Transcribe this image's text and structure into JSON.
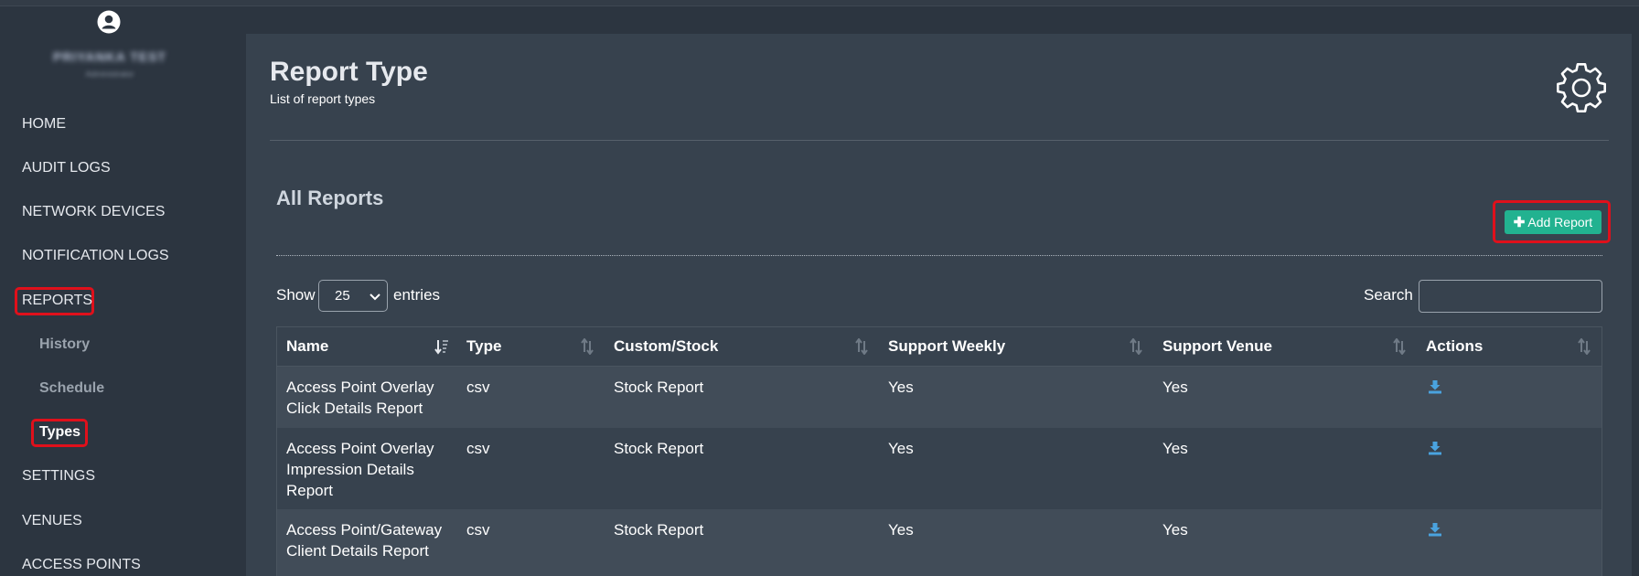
{
  "sidebar": {
    "user_name": "PRIYANKA TEST",
    "user_role": "Administrator",
    "items": [
      {
        "label": "HOME"
      },
      {
        "label": "AUDIT LOGS"
      },
      {
        "label": "NETWORK DEVICES"
      },
      {
        "label": "NOTIFICATION LOGS"
      },
      {
        "label": "REPORTS"
      },
      {
        "label": "History"
      },
      {
        "label": "Schedule"
      },
      {
        "label": "Types"
      },
      {
        "label": "SETTINGS"
      },
      {
        "label": "VENUES"
      },
      {
        "label": "ACCESS POINTS"
      }
    ]
  },
  "header": {
    "title": "Report Type",
    "subtitle": "List of report types",
    "settings_icon": "gear-icon"
  },
  "section": {
    "title": "All Reports",
    "add_button": "Add Report"
  },
  "table_controls": {
    "show_label": "Show",
    "page_size": "25",
    "entries_label": "entries",
    "search_label": "Search",
    "search_value": ""
  },
  "table": {
    "columns": [
      "Name",
      "Type",
      "Custom/Stock",
      "Support Weekly",
      "Support Venue",
      "Actions"
    ],
    "rows": [
      {
        "name": "Access Point Overlay Click Details Report",
        "type": "csv",
        "custom_stock": "Stock Report",
        "support_weekly": "Yes",
        "support_venue": "Yes"
      },
      {
        "name": "Access Point Overlay Impression Details Report",
        "type": "csv",
        "custom_stock": "Stock Report",
        "support_weekly": "Yes",
        "support_venue": "Yes"
      },
      {
        "name": "Access Point/Gateway Client Details Report",
        "type": "csv",
        "custom_stock": "Stock Report",
        "support_weekly": "Yes",
        "support_venue": "Yes"
      }
    ]
  },
  "colors": {
    "background": "#2c3540",
    "panel": "#37424e",
    "accent_button": "#22b290",
    "highlight": "#e0101b",
    "download_icon": "#4aa3df"
  }
}
